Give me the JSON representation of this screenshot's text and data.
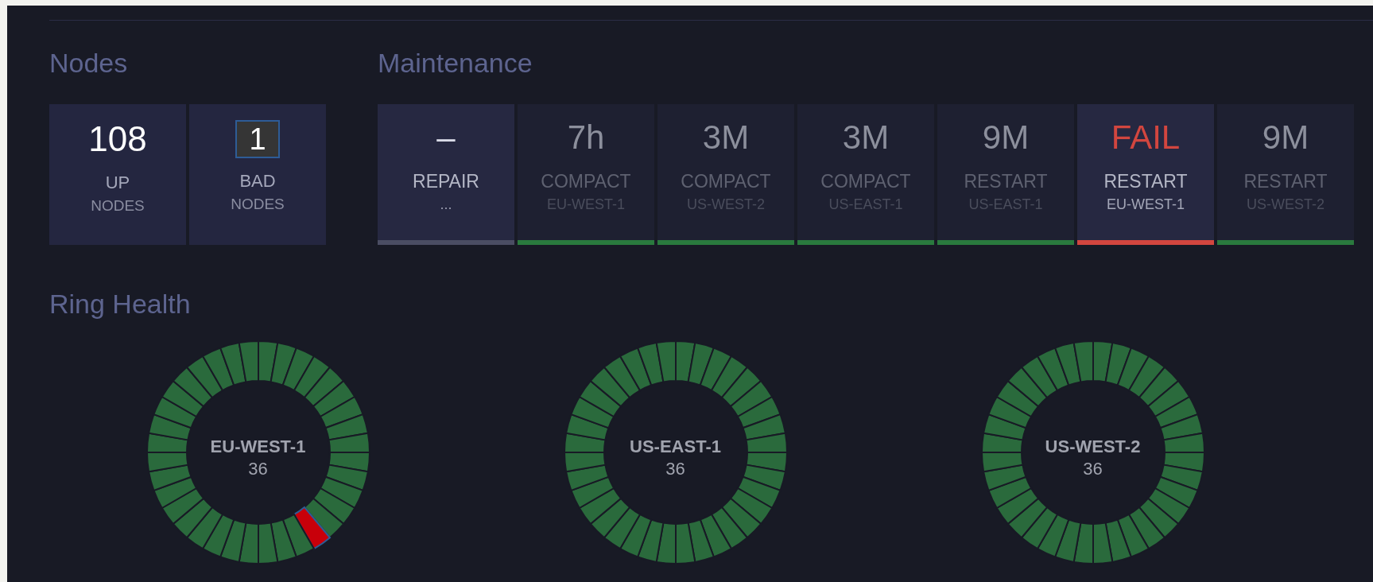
{
  "nodes": {
    "title": "Nodes",
    "cards": [
      {
        "kind": "plain",
        "value": "108",
        "label": "UP",
        "sublabel": "NODES"
      },
      {
        "kind": "boxed",
        "value": "1",
        "label": "BAD",
        "sublabel": "NODES"
      }
    ]
  },
  "maintenance": {
    "title": "Maintenance",
    "tasks": [
      {
        "kind": "pending",
        "value": "–",
        "label": "REPAIR",
        "sublabel": "..."
      },
      {
        "kind": "done",
        "value": "7h",
        "label": "COMPACT",
        "sublabel": "EU-WEST-1"
      },
      {
        "kind": "done",
        "value": "3M",
        "label": "COMPACT",
        "sublabel": "US-WEST-2"
      },
      {
        "kind": "done",
        "value": "3M",
        "label": "COMPACT",
        "sublabel": "US-EAST-1"
      },
      {
        "kind": "done",
        "value": "9M",
        "label": "RESTART",
        "sublabel": "US-EAST-1"
      },
      {
        "kind": "failed",
        "value": "FAIL",
        "label": "RESTART",
        "sublabel": "EU-WEST-1"
      },
      {
        "kind": "done",
        "value": "9M",
        "label": "RESTART",
        "sublabel": "US-WEST-2"
      }
    ]
  },
  "ring_health": {
    "title": "Ring Health",
    "rings": [
      {
        "name": "EU-WEST-1",
        "count": "36",
        "segments": [
          {
            "failed": false
          },
          {
            "failed": false
          },
          {
            "failed": false
          },
          {
            "failed": false
          },
          {
            "failed": false
          },
          {
            "failed": false
          },
          {
            "failed": false
          },
          {
            "failed": false
          },
          {
            "failed": false
          },
          {
            "failed": false
          },
          {
            "failed": false
          },
          {
            "failed": false
          },
          {
            "failed": false
          },
          {
            "failed": false
          },
          {
            "failed": true
          },
          {
            "failed": false
          },
          {
            "failed": false
          },
          {
            "failed": false
          },
          {
            "failed": false
          },
          {
            "failed": false
          },
          {
            "failed": false
          },
          {
            "failed": false
          },
          {
            "failed": false
          },
          {
            "failed": false
          },
          {
            "failed": false
          },
          {
            "failed": false
          },
          {
            "failed": false
          },
          {
            "failed": false
          },
          {
            "failed": false
          },
          {
            "failed": false
          },
          {
            "failed": false
          },
          {
            "failed": false
          },
          {
            "failed": false
          },
          {
            "failed": false
          },
          {
            "failed": false
          },
          {
            "failed": false
          }
        ]
      },
      {
        "name": "US-EAST-1",
        "count": "36",
        "segments": [
          {
            "failed": false
          },
          {
            "failed": false
          },
          {
            "failed": false
          },
          {
            "failed": false
          },
          {
            "failed": false
          },
          {
            "failed": false
          },
          {
            "failed": false
          },
          {
            "failed": false
          },
          {
            "failed": false
          },
          {
            "failed": false
          },
          {
            "failed": false
          },
          {
            "failed": false
          },
          {
            "failed": false
          },
          {
            "failed": false
          },
          {
            "failed": false
          },
          {
            "failed": false
          },
          {
            "failed": false
          },
          {
            "failed": false
          },
          {
            "failed": false
          },
          {
            "failed": false
          },
          {
            "failed": false
          },
          {
            "failed": false
          },
          {
            "failed": false
          },
          {
            "failed": false
          },
          {
            "failed": false
          },
          {
            "failed": false
          },
          {
            "failed": false
          },
          {
            "failed": false
          },
          {
            "failed": false
          },
          {
            "failed": false
          },
          {
            "failed": false
          },
          {
            "failed": false
          },
          {
            "failed": false
          },
          {
            "failed": false
          },
          {
            "failed": false
          },
          {
            "failed": false
          }
        ]
      },
      {
        "name": "US-WEST-2",
        "count": "36",
        "segments": [
          {
            "failed": false
          },
          {
            "failed": false
          },
          {
            "failed": false
          },
          {
            "failed": false
          },
          {
            "failed": false
          },
          {
            "failed": false
          },
          {
            "failed": false
          },
          {
            "failed": false
          },
          {
            "failed": false
          },
          {
            "failed": false
          },
          {
            "failed": false
          },
          {
            "failed": false
          },
          {
            "failed": false
          },
          {
            "failed": false
          },
          {
            "failed": false
          },
          {
            "failed": false
          },
          {
            "failed": false
          },
          {
            "failed": false
          },
          {
            "failed": false
          },
          {
            "failed": false
          },
          {
            "failed": false
          },
          {
            "failed": false
          },
          {
            "failed": false
          },
          {
            "failed": false
          },
          {
            "failed": false
          },
          {
            "failed": false
          },
          {
            "failed": false
          },
          {
            "failed": false
          },
          {
            "failed": false
          },
          {
            "failed": false
          },
          {
            "failed": false
          },
          {
            "failed": false
          },
          {
            "failed": false
          },
          {
            "failed": false
          },
          {
            "failed": false
          },
          {
            "failed": false
          }
        ]
      }
    ]
  }
}
